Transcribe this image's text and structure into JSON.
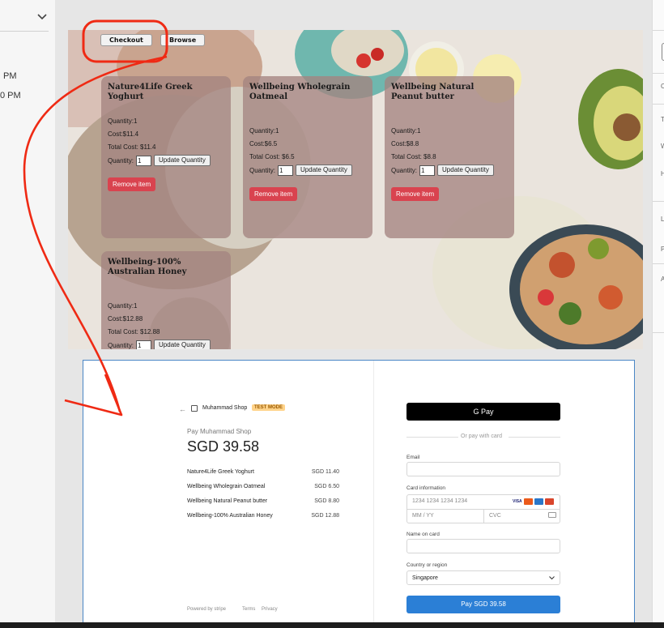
{
  "left_panel": {
    "times": [
      "PM",
      "0 PM"
    ]
  },
  "right_panel": {
    "letters": [
      "C",
      "T",
      "W",
      "H",
      "L",
      "P",
      "A"
    ]
  },
  "shop": {
    "nav": {
      "checkout": "Checkout",
      "browse": "Browse"
    },
    "quantity_label": "Quantity:",
    "update_label": "Update Quantity",
    "remove_label": "Remove item",
    "items": [
      {
        "name": "Nature4Life Greek Yoghurt",
        "quantity": "Quantity:1",
        "cost": "Cost:$11.4",
        "total": "Total Cost: $11.4",
        "qty_value": "1"
      },
      {
        "name": "Wellbeing Wholegrain Oatmeal",
        "quantity": "Quantity:1",
        "cost": "Cost:$6.5",
        "total": "Total Cost: $6.5",
        "qty_value": "1"
      },
      {
        "name": "Wellbeing Natural Peanut butter",
        "quantity": "Quantity:1",
        "cost": "Cost:$8.8",
        "total": "Total Cost: $8.8",
        "qty_value": "1"
      },
      {
        "name": "Wellbeing-100% Australian Honey",
        "quantity": "Quantity:1",
        "cost": "Cost:$12.88",
        "total": "Total Cost: $12.88",
        "qty_value": "1"
      }
    ]
  },
  "checkout": {
    "back": "←",
    "shop_name": "Muhammad Shop",
    "test_mode": "TEST MODE",
    "pay_label": "Pay Muhammad Shop",
    "total": "SGD 39.58",
    "line_items": [
      {
        "name": "Nature4Life Greek Yoghurt",
        "price": "SGD 11.40"
      },
      {
        "name": "Wellbeing Wholegrain Oatmeal",
        "price": "SGD 6.50"
      },
      {
        "name": "Wellbeing Natural Peanut butter",
        "price": "SGD 8.80"
      },
      {
        "name": "Wellbeing-100% Australian Honey",
        "price": "SGD 12.88"
      }
    ],
    "powered_by": "Powered by stripe",
    "terms": "Terms",
    "privacy": "Privacy",
    "gpay": "G Pay",
    "or_text": "Or pay with card",
    "email_label": "Email",
    "card_label": "Card information",
    "card_placeholder": "1234 1234 1234 1234",
    "expiry_placeholder": "MM / YY",
    "cvc_placeholder": "CVC",
    "visa": "VISA",
    "name_label": "Name on card",
    "country_label": "Country or region",
    "country_value": "Singapore",
    "pay_button": "Pay SGD 39.58"
  },
  "colors": {
    "accent_red": "#ef2a14",
    "pay_blue": "#2b7fd6",
    "remove_red": "#d9434f"
  }
}
